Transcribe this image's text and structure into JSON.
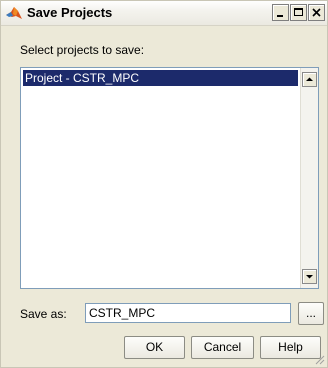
{
  "window": {
    "title": "Save Projects",
    "icon": "matlab-logo-icon"
  },
  "titlebar_buttons": {
    "minimize": "minimize-icon",
    "maximize": "maximize-icon",
    "close": "close-icon"
  },
  "projects": {
    "label": "Select projects to save:",
    "items": [
      {
        "label": "Project - CSTR_MPC",
        "selected": true
      }
    ]
  },
  "save_as": {
    "label": "Save as:",
    "value": "CSTR_MPC",
    "browse_label": "..."
  },
  "buttons": {
    "ok": "OK",
    "cancel": "Cancel",
    "help": "Help"
  },
  "colors": {
    "selection": "#1c2a6b",
    "dialog_bg": "#ece9d8"
  }
}
